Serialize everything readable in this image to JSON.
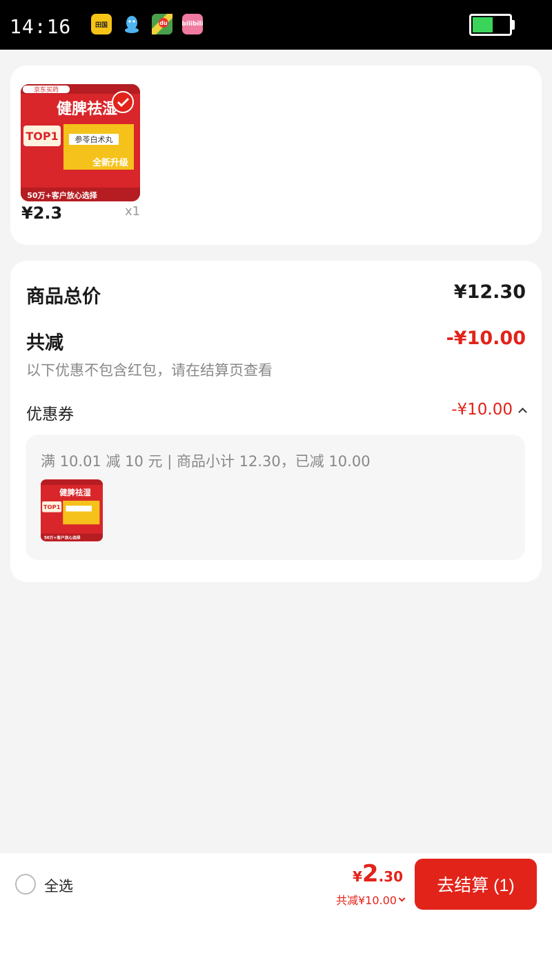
{
  "status_bar": {
    "time": "14:16",
    "app_icons": [
      "bank-app-icon",
      "qq-icon",
      "maps-icon",
      "bilibili-icon"
    ],
    "app_icon_labels": [
      "田国",
      "",
      "du",
      "bilibili"
    ],
    "battery_level": 0.55
  },
  "product": {
    "brand": "京东买药",
    "image_headline": "健脾祛湿",
    "image_badge": "TOP1",
    "image_product_name": "参苓白术丸",
    "image_slogan": "全新升级",
    "image_footer": "50万+客户放心选择",
    "price": "¥2.3",
    "quantity": "x1"
  },
  "summary": {
    "total_label": "商品总价",
    "total_value": "¥12.30",
    "discount_label": "共减",
    "discount_value": "-¥10.00",
    "discount_note": "以下优惠不包含红包，请在结算页查看",
    "coupon_label": "优惠券",
    "coupon_value": "-¥10.00",
    "coupon_desc": "满 10.01 减 10 元 | 商品小计 12.30，已减 10.00"
  },
  "bottom": {
    "select_all": "全选",
    "price_symbol": "¥",
    "price_int": "2",
    "price_dec": ".30",
    "total_discount": "共减¥10.00",
    "checkout_label": "去结算 (1)"
  },
  "colors": {
    "accent": "#e2231a",
    "background": "#f4f4f4",
    "card": "#ffffff",
    "muted_text": "#888888"
  }
}
